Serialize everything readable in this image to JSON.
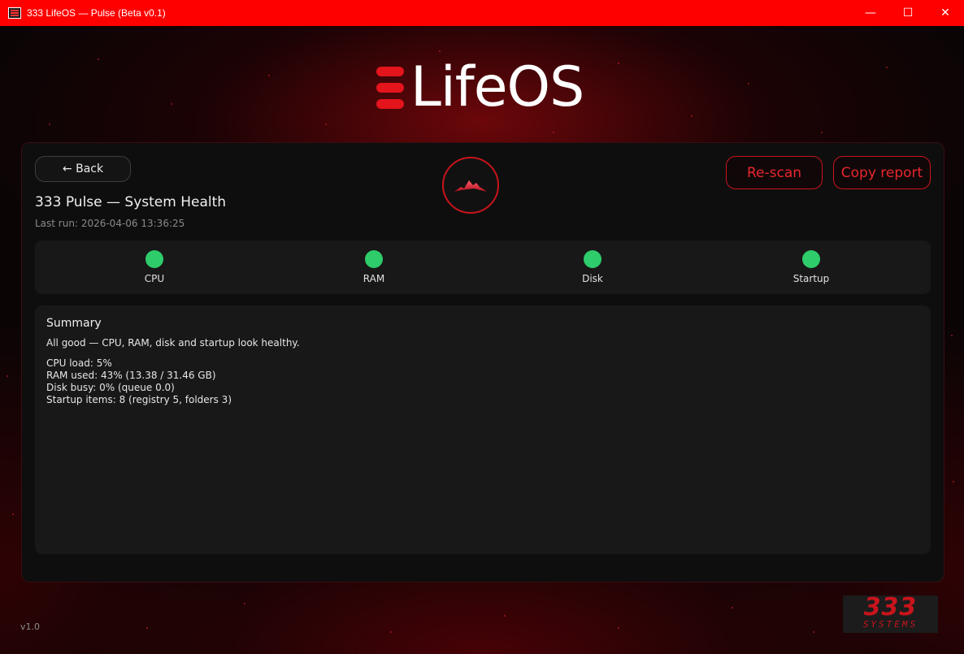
{
  "window": {
    "title": "333 LifeOS — Pulse (Beta v0.1)",
    "controls": [
      "—",
      "☐",
      "✕"
    ]
  },
  "logo": {
    "text": "LifeOS",
    "accent": "#e3141c"
  },
  "header": {
    "back_label": "← Back",
    "title": "333 Pulse — System Health",
    "last_run": "Last run: 2026-04-06 13:36:25",
    "rescan_label": "Re-scan",
    "copy_label": "Copy report"
  },
  "status": [
    {
      "label": "CPU",
      "state": "ok",
      "color": "#2ecc6a"
    },
    {
      "label": "RAM",
      "state": "ok",
      "color": "#2ecc6a"
    },
    {
      "label": "Disk",
      "state": "ok",
      "color": "#2ecc6a"
    },
    {
      "label": "Startup",
      "state": "ok",
      "color": "#2ecc6a"
    }
  ],
  "summary": {
    "title": "Summary",
    "description": "All good — CPU, RAM, disk and startup look healthy.",
    "lines": [
      "CPU load: 5%",
      "RAM used: 43% (13.38 / 31.46 GB)",
      "Disk busy: 0% (queue 0.0)",
      "Startup items: 8 (registry 5, folders 3)"
    ]
  },
  "footer": {
    "version": "v1.0",
    "brand_number": "333",
    "brand_sub": "SYSTEMS"
  },
  "colors": {
    "titlebar": "#ff0000",
    "accent": "#c8141c",
    "ok": "#2ecc6a"
  }
}
